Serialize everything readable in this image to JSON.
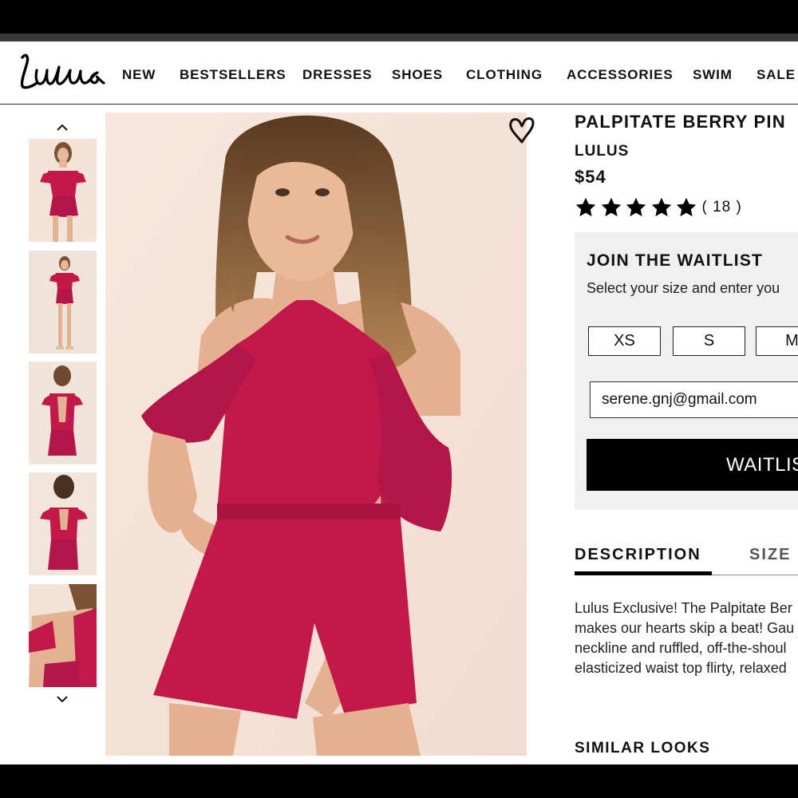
{
  "nav": {
    "logo_text": "Lulus",
    "items": [
      "NEW",
      "BESTSELLERS",
      "DRESSES",
      "SHOES",
      "CLOTHING",
      "ACCESSORIES",
      "SWIM",
      "SALE"
    ]
  },
  "gallery": {
    "up_icon": "chevron-up-icon",
    "down_icon": "chevron-down-icon",
    "thumbnail_count": 5,
    "favorite_icon": "heart-icon"
  },
  "product": {
    "title": "PALPITATE BERRY PIN",
    "brand": "LULUS",
    "price": "$54",
    "rating": {
      "stars": 5,
      "count_text": "( 18 )"
    }
  },
  "waitlist": {
    "title": "JOIN THE WAITLIST",
    "subtitle": "Select your size and enter you",
    "sizes": [
      "XS",
      "S",
      "M"
    ],
    "email_value": "serene.gnj@gmail.com",
    "button_label": "WAITLIS"
  },
  "tabs": {
    "description": "DESCRIPTION",
    "size": "SIZE"
  },
  "description": {
    "lines": [
      "Lulus Exclusive! The Palpitate Ber",
      "makes our hearts skip a beat! Gau",
      "neckline and ruffled, off-the-shoul",
      "elasticized waist top flirty, relaxed"
    ]
  },
  "similar_looks": {
    "title": "SIMILAR LOOKS"
  },
  "colors": {
    "accent": "#000000",
    "romper": "#c2184a",
    "panel_bg": "#f0f0f0"
  }
}
